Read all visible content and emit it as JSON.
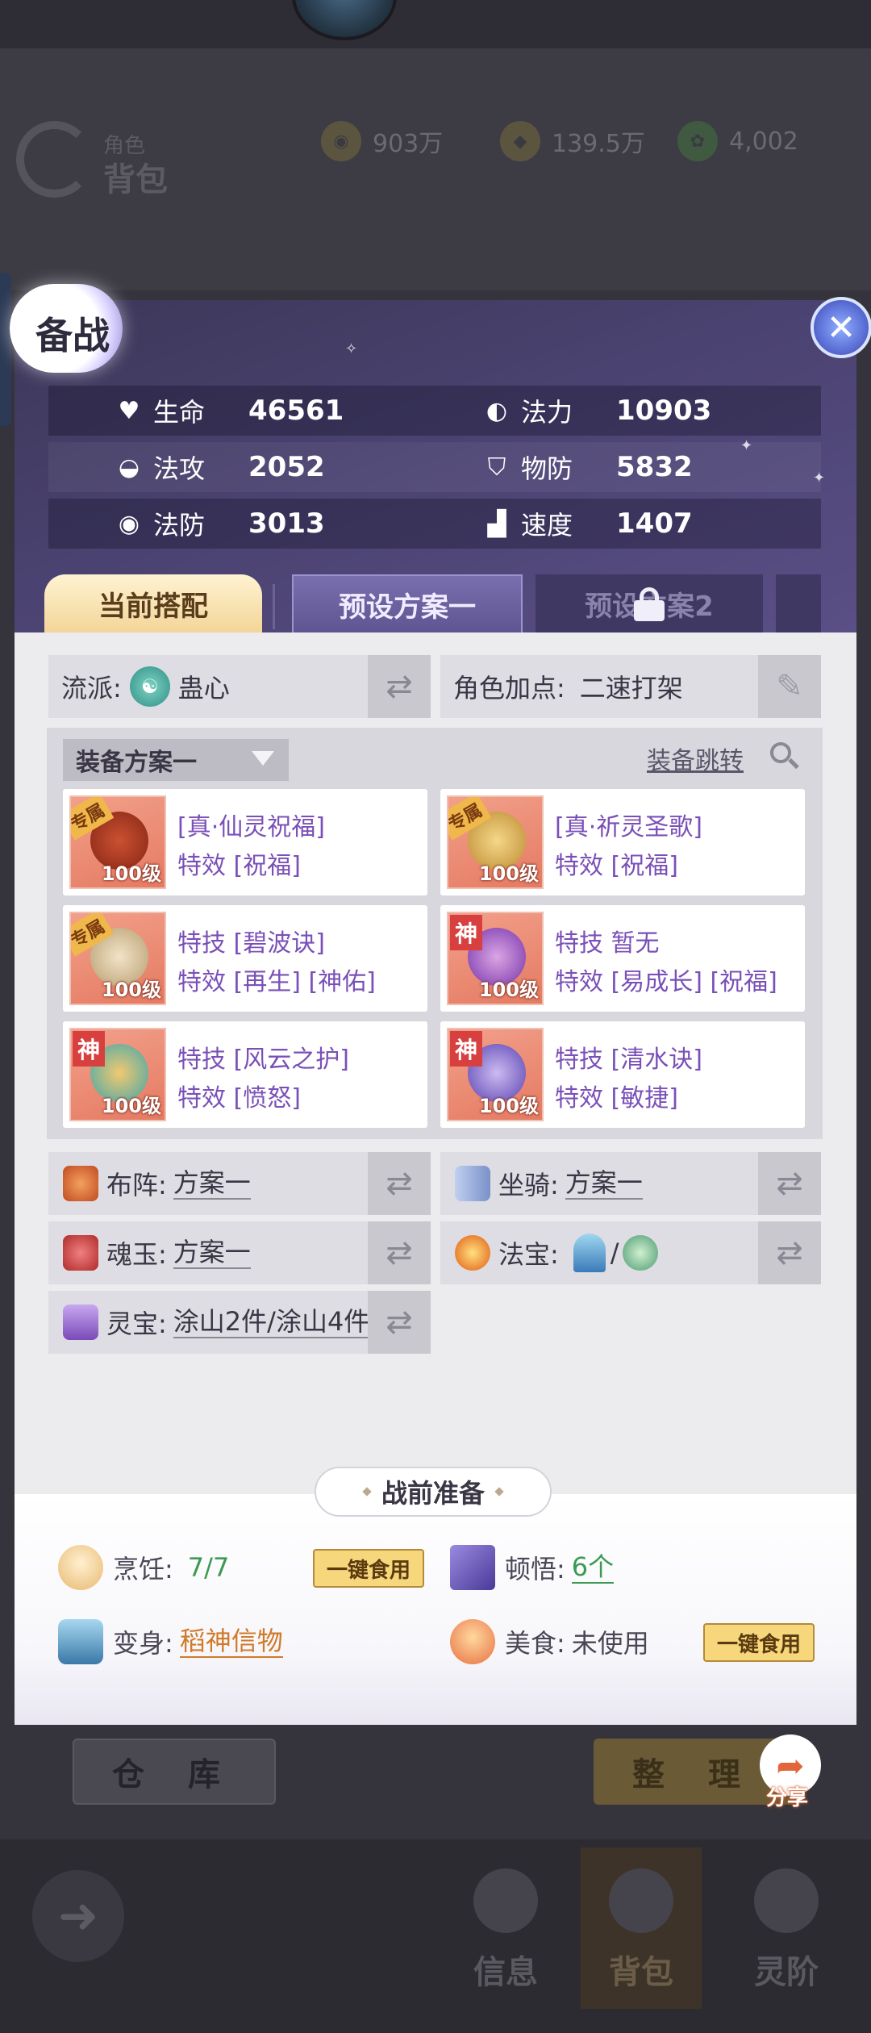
{
  "background": {
    "section_small": "角色",
    "section_title": "背包",
    "currencies": [
      {
        "icon": "coin-icon",
        "value": "903万"
      },
      {
        "icon": "gold-ingot-icon",
        "value": "139.5万"
      },
      {
        "icon": "jade-icon",
        "value": "4,002"
      }
    ],
    "storage_button": "仓 库",
    "sort_button": "整 理",
    "share_label": "分享",
    "nav": [
      "信息",
      "背包",
      "灵阶"
    ]
  },
  "modal": {
    "title": "备战",
    "close_icon": "close-icon",
    "stats": [
      {
        "icon": "heart-icon",
        "label": "生命",
        "value": "46561"
      },
      {
        "icon": "swirl-icon",
        "label": "法力",
        "value": "10903"
      },
      {
        "icon": "wave-icon",
        "label": "法攻",
        "value": "2052"
      },
      {
        "icon": "shield-icon",
        "label": "物防",
        "value": "5832"
      },
      {
        "icon": "mask-icon",
        "label": "法防",
        "value": "3013"
      },
      {
        "icon": "boot-icon",
        "label": "速度",
        "value": "1407"
      }
    ],
    "tabs": {
      "current": "当前搭配",
      "preset1": "预设方案一",
      "preset2": "预设方案2"
    },
    "school": {
      "label": "流派:",
      "value": "蛊心"
    },
    "role_points": {
      "label": "角色加点:",
      "value": "二速打架"
    },
    "equipment": {
      "plan": "装备方案一",
      "jump": "装备跳转",
      "items": [
        {
          "tag": "专属",
          "level": "100级",
          "line1": "[真·仙灵祝福]",
          "line2": "特效 [祝福]",
          "art": "#c84a2a"
        },
        {
          "tag": "专属",
          "level": "100级",
          "line1": "[真·祈灵圣歌]",
          "line2": "特效 [祝福]",
          "art": "#e9c060"
        },
        {
          "tag": "专属",
          "level": "100级",
          "line1": "特技 [碧波诀]",
          "line2": "特效 [再生] [神佑]",
          "art": "#e0d0a0"
        },
        {
          "tag": "神",
          "level": "100级",
          "line1": "特技 暂无",
          "line2": "特效 [易成长] [祝福]",
          "art": "#9a5ad0"
        },
        {
          "tag": "神",
          "level": "100级",
          "line1": "特技 [风云之护]",
          "line2": "特效 [愤怒]",
          "art": "#e0b040"
        },
        {
          "tag": "神",
          "level": "100级",
          "line1": "特技 [清水诀]",
          "line2": "特效 [敏捷]",
          "art": "#6a5ad8"
        }
      ]
    },
    "formation": {
      "label": "布阵:",
      "value": "方案一"
    },
    "mount": {
      "label": "坐骑:",
      "value": "方案一"
    },
    "soul_jade": {
      "label": "魂玉:",
      "value": "方案一"
    },
    "treasure": {
      "label": "法宝:",
      "value": "/"
    },
    "spirit_treasure": {
      "label": "灵宝:",
      "value": "涂山2件/涂山4件"
    },
    "prep": {
      "title": "战前准备",
      "cooking": {
        "label": "烹饪:",
        "value": "7/7",
        "button": "一键食用",
        "color": "#3c9a52"
      },
      "insight": {
        "label": "顿悟:",
        "value": "6个",
        "color": "#3c9a52"
      },
      "transform": {
        "label": "变身:",
        "value": "稻神信物",
        "color": "#d07a2a"
      },
      "food": {
        "label": "美食:",
        "value": "未使用",
        "button": "一键食用"
      }
    }
  }
}
